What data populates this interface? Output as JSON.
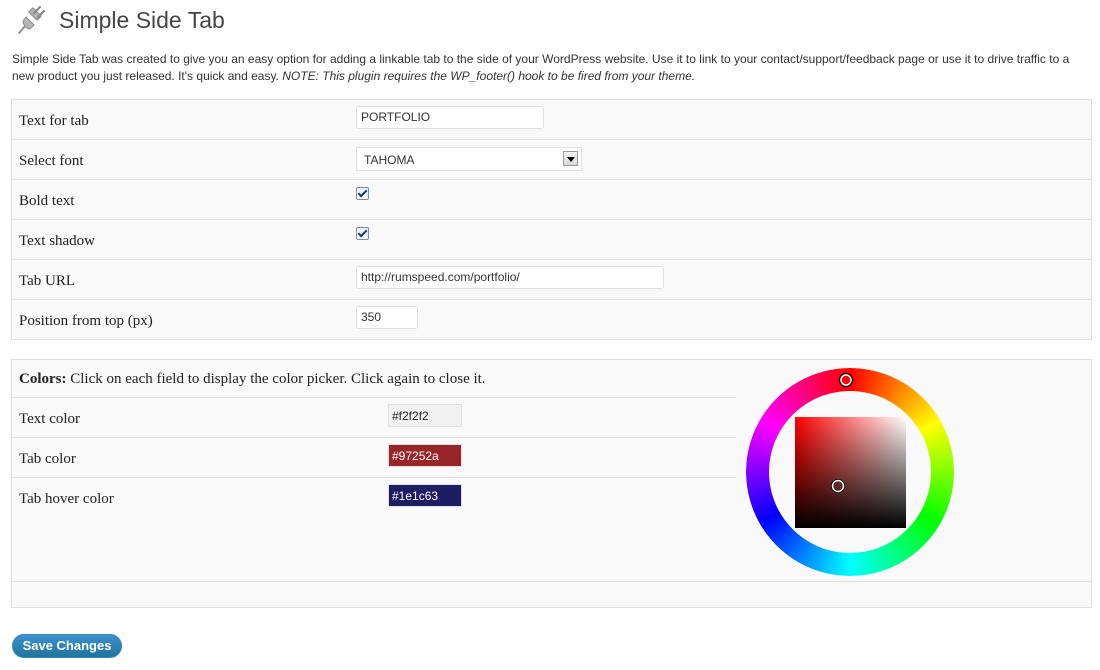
{
  "page": {
    "title": "Simple Side Tab",
    "intro_text": "Simple Side Tab was created to give you an easy option for adding a linkable tab to the side of your WordPress website. Use it to link to your contact/support/feedback page or use it to drive traffic to a new product you just released. It's quick and easy.",
    "intro_note": "NOTE: This plugin requires the WP_footer() hook to be fired from your theme."
  },
  "settings": {
    "text_for_tab": {
      "label": "Text for tab",
      "value": "PORTFOLIO"
    },
    "select_font": {
      "label": "Select font",
      "value": "TAHOMA"
    },
    "bold_text": {
      "label": "Bold text",
      "checked": true
    },
    "text_shadow": {
      "label": "Text shadow",
      "checked": true
    },
    "tab_url": {
      "label": "Tab URL",
      "value": "http://rumspeed.com/portfolio/"
    },
    "position_from_top": {
      "label": "Position from top (px)",
      "value": "350"
    }
  },
  "colors": {
    "heading_bold": "Colors:",
    "heading_text": "Click on each field to display the color picker. Click again to close it.",
    "text_color": {
      "label": "Text color",
      "value": "#f2f2f2"
    },
    "tab_color": {
      "label": "Tab color",
      "value": "#97252a"
    },
    "tab_hover_color": {
      "label": "Tab hover color",
      "value": "#1e1c63"
    }
  },
  "actions": {
    "save_label": "Save Changes"
  },
  "theme": {
    "primary_button": "#21759b",
    "panel_bg": "#f9f9f9",
    "border": "#dfdfdf"
  }
}
